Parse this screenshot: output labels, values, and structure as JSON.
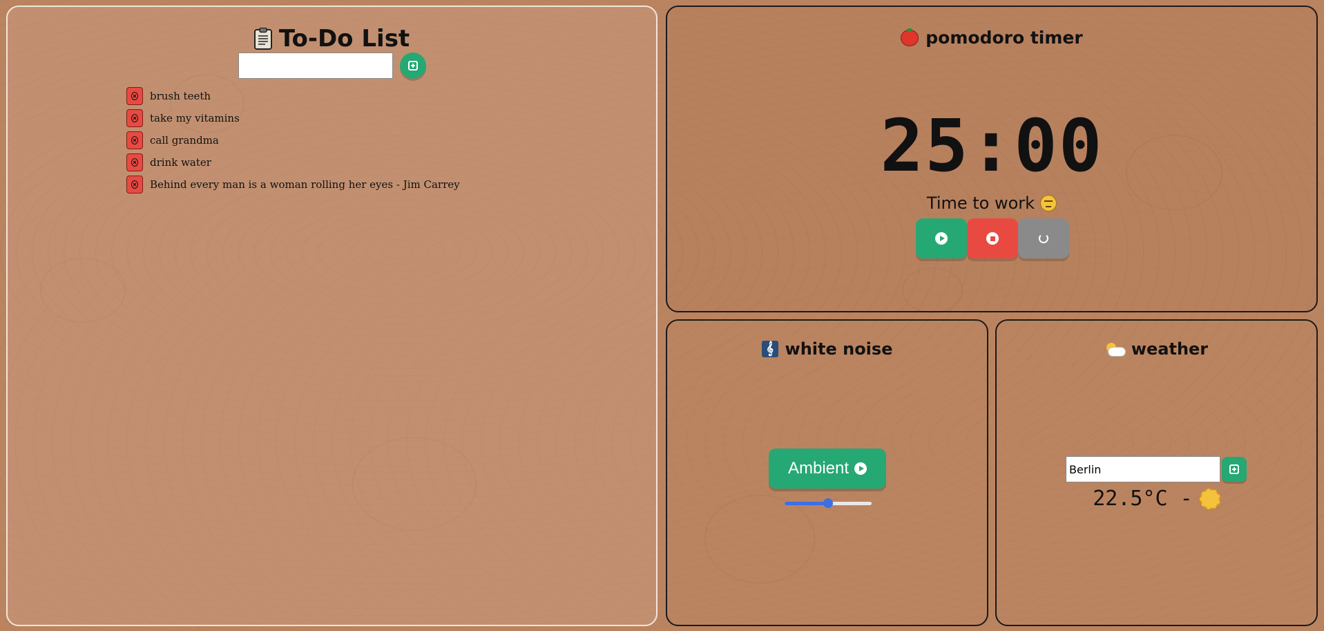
{
  "todo": {
    "title": "To-Do List",
    "input_value": "",
    "items": [
      {
        "text": "brush teeth"
      },
      {
        "text": "take my vitamins"
      },
      {
        "text": "call grandma"
      },
      {
        "text": "drink water"
      },
      {
        "text": "Behind every man is a woman rolling her eyes - Jim Carrey"
      }
    ]
  },
  "pomodoro": {
    "title": "pomodoro timer",
    "time": "25:00",
    "status": "Time to work"
  },
  "white_noise": {
    "title": "white noise",
    "button_label": "Ambient",
    "volume": 0.5
  },
  "weather": {
    "title": "weather",
    "city_value": "Berlin",
    "reading": "22.5°C -"
  },
  "colors": {
    "background": "#bb8460",
    "accent_green": "#25a874",
    "danger_red": "#e84a42",
    "neutral_gray": "#8a8a8a",
    "slider_blue": "#3a6fe6"
  },
  "icons": {
    "todo": "clipboard-icon",
    "pomodoro": "tomato-icon",
    "status": "tired-face-icon",
    "white_noise": "treble-clef-icon",
    "weather": "sun-behind-cloud-icon",
    "condition": "sun-icon"
  }
}
